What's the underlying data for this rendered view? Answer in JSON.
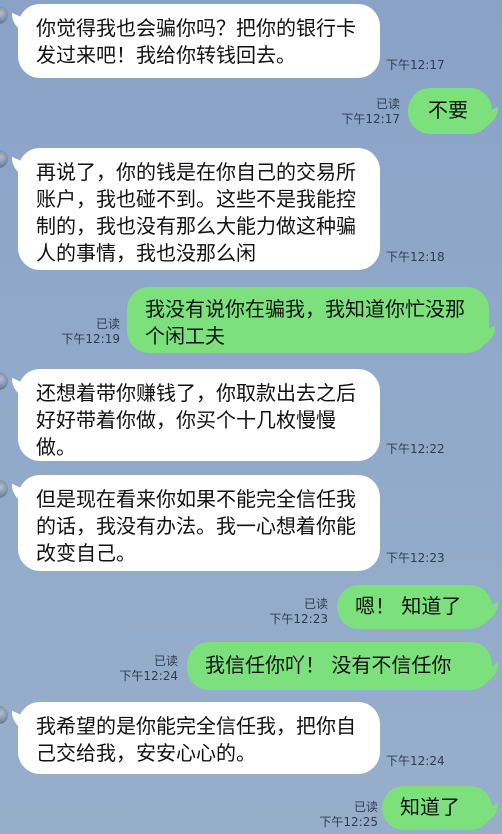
{
  "colors": {
    "background": "#8fa7c9",
    "incoming_bubble": "#ffffff",
    "outgoing_bubble": "#7ce07d",
    "meta_text": "#2f3c52"
  },
  "messages": [
    {
      "id": 1,
      "side": "in",
      "text": "你觉得我也会骗你吗？把你的银行卡发过来吧！我给你转钱回去。",
      "time": "下午12:17"
    },
    {
      "id": 2,
      "side": "out",
      "text": "不要",
      "read": "已读",
      "time": "下午12:17"
    },
    {
      "id": 3,
      "side": "in",
      "text": "再说了，你的钱是在你自己的交易所账户，我也碰不到。这些不是我能控制的，我也没有那么大能力做这种骗人的事情，我也没那么闲",
      "time": "下午12:18"
    },
    {
      "id": 4,
      "side": "out",
      "text": "我没有说你在骗我，我知道你忙没那个闲工夫",
      "read": "已读",
      "time": "下午12:19"
    },
    {
      "id": 5,
      "side": "in",
      "text": "还想着带你赚钱了，你取款出去之后好好带着你做，你买个十几枚慢慢做。",
      "time": "下午12:22"
    },
    {
      "id": 6,
      "side": "in",
      "text": "但是现在看来你如果不能完全信任我的话，我没有办法。我一心想着你能改变自己。",
      "time": "下午12:23"
    },
    {
      "id": 7,
      "side": "out",
      "text": "嗯！ 知道了",
      "read": "已读",
      "time": "下午12:23"
    },
    {
      "id": 8,
      "side": "out",
      "text": "我信任你吖！ 没有不信任你",
      "read": "已读",
      "time": "下午12:24"
    },
    {
      "id": 9,
      "side": "in",
      "text": "我希望的是你能完全信任我，把你自己交给我，安安心心的。",
      "time": "下午12:24"
    },
    {
      "id": 10,
      "side": "out",
      "text": "知道了",
      "read": "已读",
      "time": "下午12:25"
    }
  ]
}
